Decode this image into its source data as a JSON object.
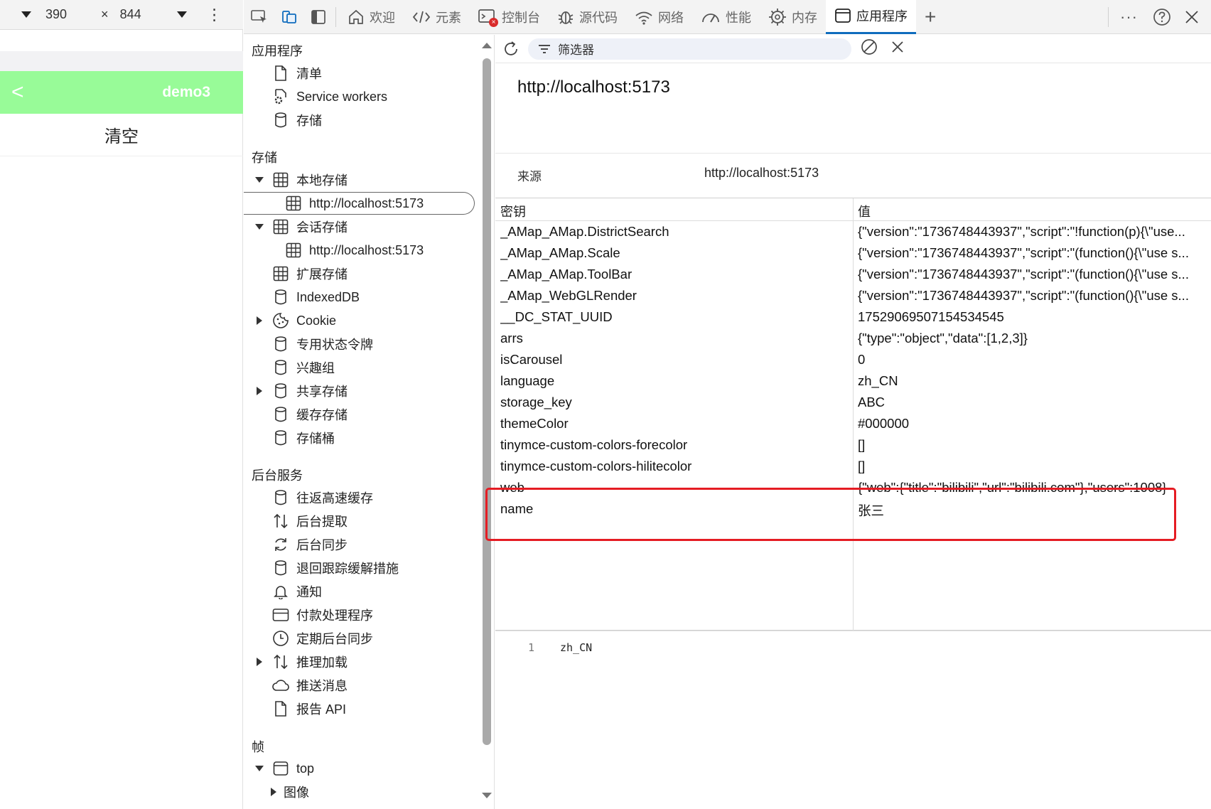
{
  "device": {
    "width": "390",
    "times": "×",
    "height": "844",
    "header_title": "demo3",
    "back_glyph": "<",
    "clear_label": "清空"
  },
  "tabs": [
    {
      "label": "欢迎",
      "icon": "home-icon"
    },
    {
      "label": "元素",
      "icon": "code-icon"
    },
    {
      "label": "控制台",
      "icon": "console-icon"
    },
    {
      "label": "源代码",
      "icon": "bug-icon"
    },
    {
      "label": "网络",
      "icon": "wifi-icon"
    },
    {
      "label": "性能",
      "icon": "gauge-icon"
    },
    {
      "label": "内存",
      "icon": "chip-icon"
    },
    {
      "label": "应用程序",
      "icon": "window-icon",
      "active": true
    }
  ],
  "add_tab": "+",
  "sidebar": {
    "section_app": "应用程序",
    "app_items": [
      "清单",
      "Service workers",
      "存储"
    ],
    "section_storage": "存储",
    "local_storage": "本地存储",
    "local_origin": "http://localhost:5173",
    "session_storage": "会话存储",
    "session_origin": "http://localhost:5173",
    "storage_items": [
      "扩展存储",
      "IndexedDB",
      "Cookie",
      "专用状态令牌",
      "兴趣组",
      "共享存储",
      "缓存存储",
      "存储桶"
    ],
    "section_bg": "后台服务",
    "bg_items": [
      "往返高速缓存",
      "后台提取",
      "后台同步",
      "退回跟踪缓解措施",
      "通知",
      "付款处理程序",
      "定期后台同步",
      "推理加载",
      "推送消息",
      "报告 API"
    ],
    "section_frames": "帧",
    "frame_top": "top",
    "frame_images": "图像"
  },
  "filter": {
    "placeholder": "筛选器"
  },
  "origin": {
    "title": "http://localhost:5173",
    "label": "来源",
    "value": "http://localhost:5173"
  },
  "table": {
    "col_key": "密钥",
    "col_value": "值",
    "rows": [
      {
        "key": "_AMap_AMap.DistrictSearch",
        "value": "{\"version\":\"1736748443937\",\"script\":\"!function(p){\\\"use..."
      },
      {
        "key": "_AMap_AMap.Scale",
        "value": "{\"version\":\"1736748443937\",\"script\":\"(function(){\\\"use s..."
      },
      {
        "key": "_AMap_AMap.ToolBar",
        "value": "{\"version\":\"1736748443937\",\"script\":\"(function(){\\\"use s..."
      },
      {
        "key": "_AMap_WebGLRender",
        "value": "{\"version\":\"1736748443937\",\"script\":\"(function(){\\\"use s..."
      },
      {
        "key": "__DC_STAT_UUID",
        "value": "17529069507154534545"
      },
      {
        "key": "arrs",
        "value": "{\"type\":\"object\",\"data\":[1,2,3]}"
      },
      {
        "key": "isCarousel",
        "value": "0"
      },
      {
        "key": "language",
        "value": "zh_CN"
      },
      {
        "key": "storage_key",
        "value": "ABC"
      },
      {
        "key": "themeColor",
        "value": "#000000"
      },
      {
        "key": "tinymce-custom-colors-forecolor",
        "value": "[]"
      },
      {
        "key": "tinymce-custom-colors-hilitecolor",
        "value": "[]"
      },
      {
        "key": "web",
        "value": "{\"web\":{\"title\":\"bilibili\",\"url\":\"bilibili.com\"},\"users\":1008}"
      },
      {
        "key": "name",
        "value": "张三"
      }
    ]
  },
  "preview": {
    "line_no": "1",
    "content": "zh_CN"
  },
  "colors": {
    "device_header": "#98fb98",
    "active_tab_underline": "#0f6cbd",
    "highlight_box": "#e51c23"
  }
}
